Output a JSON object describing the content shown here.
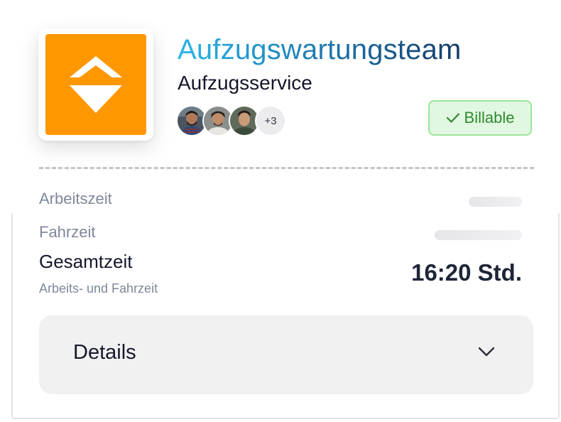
{
  "team": {
    "title": "Aufzugswartungsteam",
    "subtitle": "Aufzugsservice",
    "logo_icon": "elevator-diamond-logo",
    "logo_color": "#ff9800",
    "members_extra": "+3"
  },
  "badge": {
    "label": "Billable",
    "icon": "checkmark-icon",
    "color": "#2e8b2e"
  },
  "times": {
    "work_label": "Arbeitszeit",
    "travel_label": "Fahrzeit",
    "total_label": "Gesamtzeit",
    "total_sub": "Arbeits- und Fahrzeit",
    "total_value": "16:20 Std."
  },
  "details": {
    "label": "Details",
    "icon": "chevron-down-icon"
  }
}
